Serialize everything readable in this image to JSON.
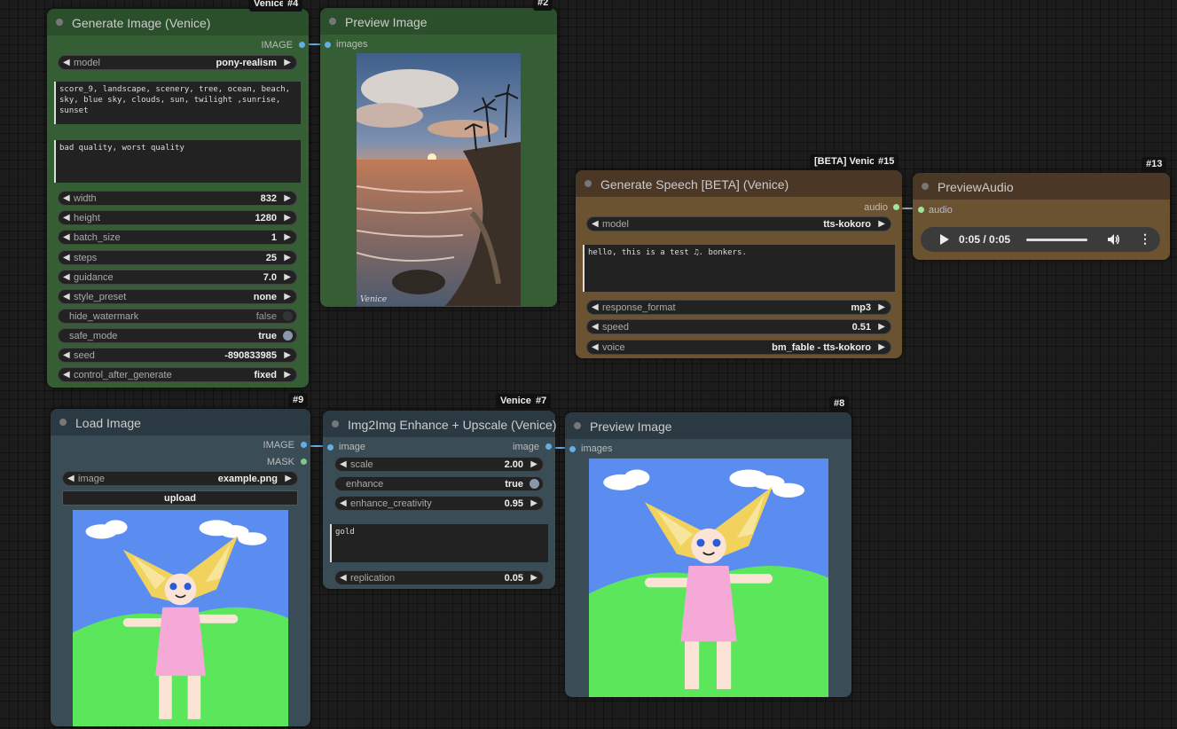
{
  "colors": {
    "image_slot": "#62aee6",
    "mask_slot": "#81c784",
    "audio_slot": "#9fe39c",
    "green_node": "#355e35",
    "blue_node": "#3a4c55",
    "brown_node": "#6b5332"
  },
  "nodes": {
    "gen_image": {
      "title": "Generate Image (Venice)",
      "badge_label": "Venice-",
      "badge_id": "#4",
      "output": "IMAGE",
      "model": {
        "label": "model",
        "value": "pony-realism"
      },
      "positive_prompt": "score_9, landscape, scenery, tree, ocean, beach,\nsky, blue sky, clouds, sun, twilight ,sunrise,\nsunset",
      "negative_prompt": "bad quality, worst quality",
      "width": {
        "label": "width",
        "value": "832"
      },
      "height": {
        "label": "height",
        "value": "1280"
      },
      "batch_size": {
        "label": "batch_size",
        "value": "1"
      },
      "steps": {
        "label": "steps",
        "value": "25"
      },
      "guidance": {
        "label": "guidance",
        "value": "7.0"
      },
      "style_preset": {
        "label": "style_preset",
        "value": "none"
      },
      "hide_watermark": {
        "label": "hide_watermark",
        "value": "false"
      },
      "safe_mode": {
        "label": "safe_mode",
        "value": "true"
      },
      "seed": {
        "label": "seed",
        "value": "-890833985"
      },
      "control_after_generate": {
        "label": "control_after_generate",
        "value": "fixed"
      }
    },
    "preview1": {
      "title": "Preview Image",
      "badge_id": "#2",
      "input": "images",
      "watermark": "Venice"
    },
    "speech": {
      "title": "Generate Speech [BETA] (Venice)",
      "badge_label": "[BETA] Venice",
      "badge_id": "#15",
      "output": "audio",
      "model": {
        "label": "model",
        "value": "tts-kokoro"
      },
      "text": "hello, this is a test ♫. bonkers.",
      "response_format": {
        "label": "response_format",
        "value": "mp3"
      },
      "speed": {
        "label": "speed",
        "value": "0.51"
      },
      "voice": {
        "label": "voice",
        "value": "bm_fable - tts-kokoro"
      }
    },
    "preview_audio": {
      "title": "PreviewAudio",
      "badge_id": "#13",
      "input": "audio",
      "time": "0:05 / 0:05"
    },
    "load_image": {
      "title": "Load Image",
      "badge_id": "#9",
      "output_image": "IMAGE",
      "output_mask": "MASK",
      "image": {
        "label": "image",
        "value": "example.png"
      },
      "upload_label": "upload"
    },
    "img2img": {
      "title": "Img2Img Enhance + Upscale (Venice)",
      "badge_label": "Venice-",
      "badge_id": "#7",
      "input": "image",
      "output": "image",
      "scale": {
        "label": "scale",
        "value": "2.00"
      },
      "enhance": {
        "label": "enhance",
        "value": "true"
      },
      "enhance_creativity": {
        "label": "enhance_creativity",
        "value": "0.95"
      },
      "prompt": "gold",
      "replication": {
        "label": "replication",
        "value": "0.05"
      }
    },
    "preview2": {
      "title": "Preview Image",
      "badge_id": "#8",
      "input": "images"
    }
  }
}
